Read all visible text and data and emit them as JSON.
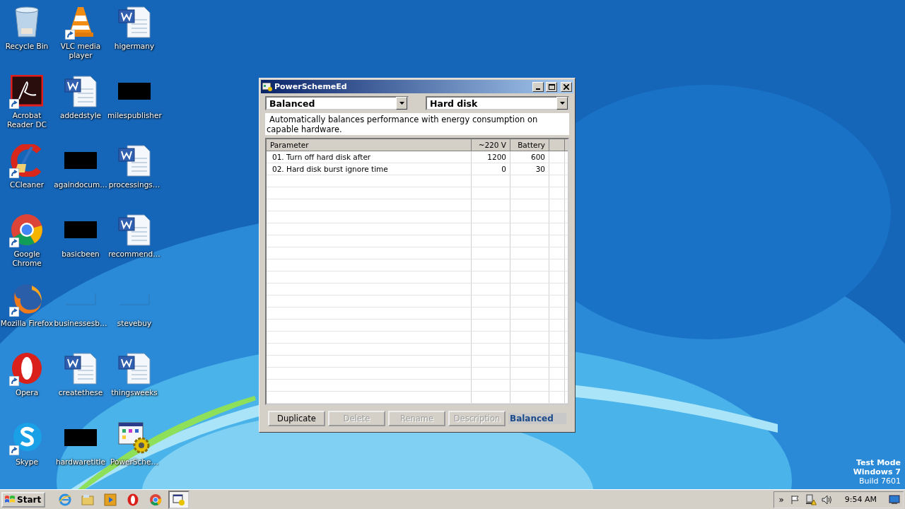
{
  "desktop_icons": [
    {
      "label": "Recycle Bin",
      "kind": "recycle",
      "shortcut": false
    },
    {
      "label": "VLC media player",
      "kind": "vlc",
      "shortcut": true
    },
    {
      "label": "higermany",
      "kind": "word",
      "shortcut": false
    },
    {
      "label": "Acrobat Reader DC",
      "kind": "acrobat",
      "shortcut": true
    },
    {
      "label": "addedstyle",
      "kind": "word",
      "shortcut": false
    },
    {
      "label": "milespublisher",
      "kind": "black",
      "shortcut": false
    },
    {
      "label": "CCleaner",
      "kind": "ccleaner",
      "shortcut": true
    },
    {
      "label": "againdocum…",
      "kind": "black",
      "shortcut": false
    },
    {
      "label": "processings…",
      "kind": "word",
      "shortcut": false
    },
    {
      "label": "Google Chrome",
      "kind": "chrome",
      "shortcut": true
    },
    {
      "label": "basicbeen",
      "kind": "black",
      "shortcut": false
    },
    {
      "label": "recommend…",
      "kind": "word",
      "shortcut": false
    },
    {
      "label": "Mozilla Firefox",
      "kind": "firefox",
      "shortcut": true
    },
    {
      "label": "businessesb…",
      "kind": "blank",
      "shortcut": false
    },
    {
      "label": "stevebuy",
      "kind": "blank",
      "shortcut": false
    },
    {
      "label": "Opera",
      "kind": "opera",
      "shortcut": true
    },
    {
      "label": "createthese",
      "kind": "word",
      "shortcut": false
    },
    {
      "label": "thingsweeks",
      "kind": "word",
      "shortcut": false
    },
    {
      "label": "Skype",
      "kind": "skype",
      "shortcut": true
    },
    {
      "label": "hardwaretitle",
      "kind": "black",
      "shortcut": false
    },
    {
      "label": "PowerSche…",
      "kind": "app",
      "shortcut": false
    }
  ],
  "window": {
    "title": "PowerSchemeEd",
    "scheme_dropdown": {
      "value": "Balanced"
    },
    "category_dropdown": {
      "value": "Hard disk"
    },
    "description": "Automatically balances performance with energy consumption on capable hardware.",
    "table": {
      "columns": [
        "Parameter",
        "~220 V",
        "Battery"
      ],
      "rows": [
        {
          "parameter": "01. Turn off hard disk after",
          "ac": "1200",
          "battery": "600"
        },
        {
          "parameter": "02. Hard disk burst ignore time",
          "ac": "0",
          "battery": "30"
        }
      ]
    },
    "buttons": [
      {
        "label": "Duplicate",
        "disabled": false
      },
      {
        "label": "Delete",
        "disabled": true
      },
      {
        "label": "Rename",
        "disabled": true
      },
      {
        "label": "Description",
        "disabled": true
      }
    ],
    "active_scheme": "Balanced"
  },
  "watermark_text": [
    "Test Mode",
    "Windows 7",
    "Build 7601"
  ],
  "taskbar": {
    "start": "Start",
    "apps": [
      {
        "kind": "ie",
        "active": false
      },
      {
        "kind": "explorer",
        "active": false
      },
      {
        "kind": "media",
        "active": false
      },
      {
        "kind": "opera",
        "active": false
      },
      {
        "kind": "chrome",
        "active": false
      },
      {
        "kind": "app",
        "active": true
      }
    ],
    "tray": {
      "chevron": "»",
      "time": "9:54 AM"
    }
  }
}
